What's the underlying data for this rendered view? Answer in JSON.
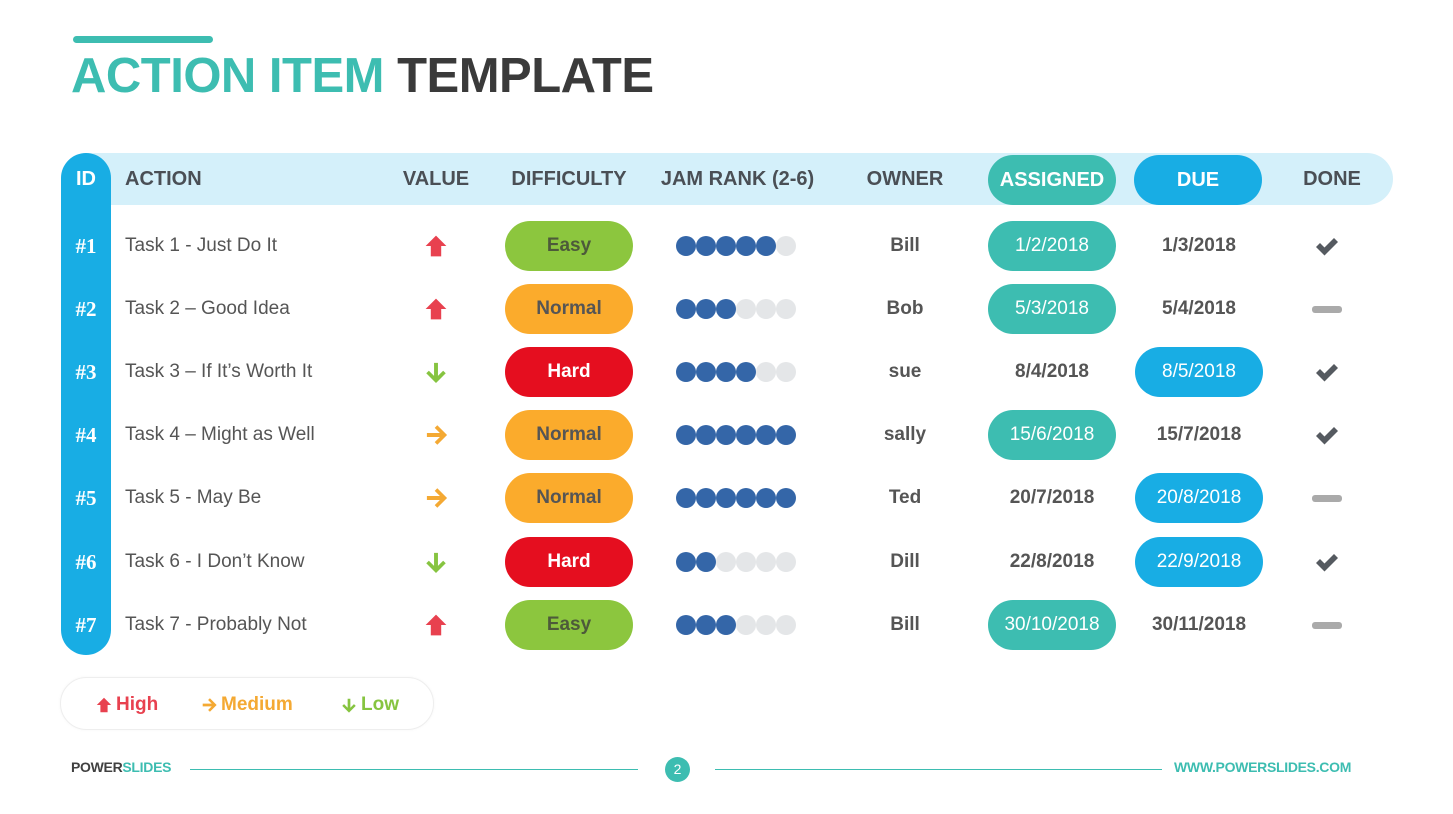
{
  "title": {
    "part1": "ACTION ITEM",
    "part2": "TEMPLATE"
  },
  "columns": {
    "id": "ID",
    "action": "ACTION",
    "value": "VALUE",
    "difficulty": "DIFFICULTY",
    "jam_rank": "JAM RANK (2-6)",
    "owner": "OWNER",
    "assigned": "ASSIGNED",
    "due": "DUE",
    "done": "DONE"
  },
  "colors": {
    "teal": "#3dbdb1",
    "blue": "#18ade4",
    "header_bg": "#d4f0fa",
    "easy": "#8cc63e",
    "normal": "#fbab2c",
    "hard": "#e50e1f",
    "high": "#e8414f",
    "medium": "#f4a933",
    "low": "#86c440",
    "jam_on": "#3466a8",
    "jam_off": "#e4e6e8"
  },
  "jam_max": 6,
  "rows": [
    {
      "id": "#1",
      "action": "Task 1 - Just Do It",
      "value": "high",
      "value_icon": "arrow-up-icon",
      "difficulty": "Easy",
      "jam_rank": 5,
      "owner": "Bill",
      "assigned": "1/2/2018",
      "due": "1/3/2018",
      "highlight": "assigned",
      "done": true,
      "done_icon": "checkmark-icon"
    },
    {
      "id": "#2",
      "action": "Task 2 – Good Idea",
      "value": "high",
      "value_icon": "arrow-up-icon",
      "difficulty": "Normal",
      "jam_rank": 3,
      "owner": "Bob",
      "assigned": "5/3/2018",
      "due": "5/4/2018",
      "highlight": "assigned",
      "done": false,
      "done_icon": "dash-icon"
    },
    {
      "id": "#3",
      "action": "Task 3 – If It’s Worth It",
      "value": "low",
      "value_icon": "arrow-down-icon",
      "difficulty": "Hard",
      "jam_rank": 4,
      "owner": "sue",
      "assigned": "8/4/2018",
      "due": "8/5/2018",
      "highlight": "due",
      "done": true,
      "done_icon": "checkmark-icon"
    },
    {
      "id": "#4",
      "action": "Task 4 – Might as Well",
      "value": "medium",
      "value_icon": "arrow-right-icon",
      "difficulty": "Normal",
      "jam_rank": 6,
      "owner": "sally",
      "assigned": "15/6/2018",
      "due": "15/7/2018",
      "highlight": "assigned",
      "done": true,
      "done_icon": "checkmark-icon"
    },
    {
      "id": "#5",
      "action": "Task 5 - May Be",
      "value": "medium",
      "value_icon": "arrow-right-icon",
      "difficulty": "Normal",
      "jam_rank": 6,
      "owner": "Ted",
      "assigned": "20/7/2018",
      "due": "20/8/2018",
      "highlight": "due",
      "done": false,
      "done_icon": "dash-icon"
    },
    {
      "id": "#6",
      "action": "Task 6 - I Don’t Know",
      "value": "low",
      "value_icon": "arrow-down-icon",
      "difficulty": "Hard",
      "jam_rank": 2,
      "owner": "Dill",
      "assigned": "22/8/2018",
      "due": "22/9/2018",
      "highlight": "due",
      "done": true,
      "done_icon": "checkmark-icon"
    },
    {
      "id": "#7",
      "action": "Task 7 - Probably Not",
      "value": "high",
      "value_icon": "arrow-up-icon",
      "difficulty": "Easy",
      "jam_rank": 3,
      "owner": "Bill",
      "assigned": "30/10/2018",
      "due": "30/11/2018",
      "highlight": "assigned",
      "done": false,
      "done_icon": "dash-icon"
    }
  ],
  "legend": {
    "high": {
      "label": "High",
      "icon": "arrow-up-icon"
    },
    "medium": {
      "label": "Medium",
      "icon": "arrow-right-icon"
    },
    "low": {
      "label": "Low",
      "icon": "arrow-down-icon"
    }
  },
  "footer": {
    "brand_part1": "POWER",
    "brand_part2": "SLIDES",
    "page_number": "2",
    "url": "WWW.POWERSLIDES.COM"
  }
}
